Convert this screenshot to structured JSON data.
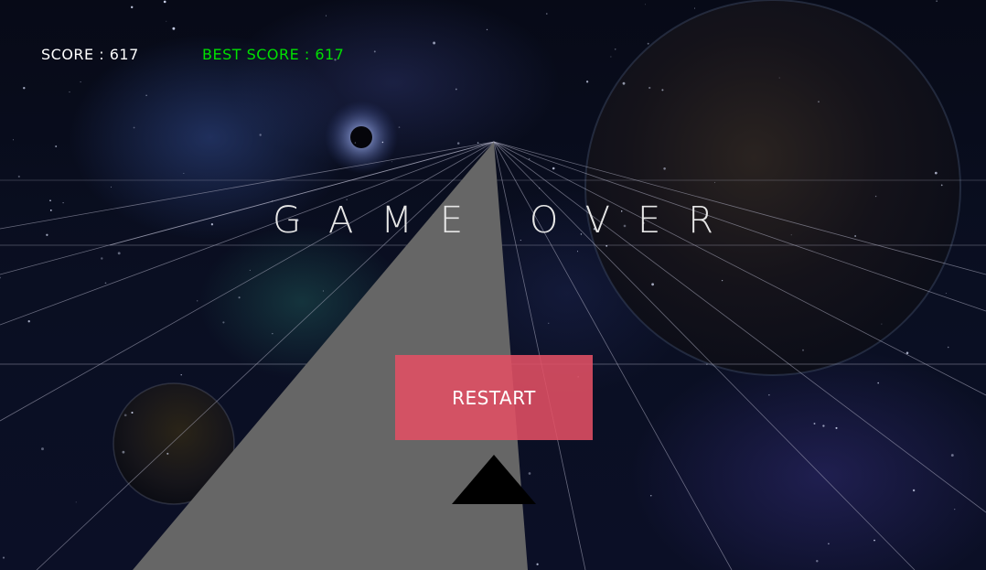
{
  "hud": {
    "score_label": "SCORE : 617",
    "best_score_label": "BEST SCORE : 617",
    "score": 617,
    "best_score": 617
  },
  "game_over": {
    "title": "GAME OVER",
    "restart_label": "RESTART"
  },
  "colors": {
    "score_text": "#ffffff",
    "best_score_text": "#00e000",
    "restart_button": "#e25064",
    "track": "#666666",
    "player": "#000000",
    "grid_lines": "#b4b4c8"
  }
}
